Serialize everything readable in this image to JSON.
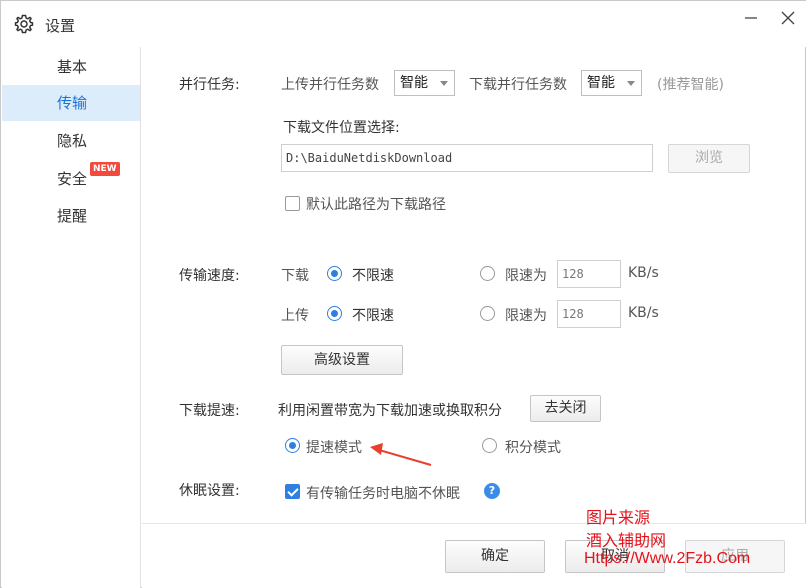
{
  "window": {
    "title": "设置"
  },
  "sidebar": {
    "items": [
      {
        "label": "基本"
      },
      {
        "label": "传输"
      },
      {
        "label": "隐私"
      },
      {
        "label": "安全",
        "badge": "NEW"
      },
      {
        "label": "提醒"
      }
    ],
    "active": "传输"
  },
  "parallel": {
    "label": "并行任务:",
    "upload_label": "上传并行任务数",
    "upload_value": "智能",
    "download_label": "下载并行任务数",
    "download_value": "智能",
    "hint": "(推荐智能)"
  },
  "download_location": {
    "label": "下载文件位置选择:",
    "path": "D:\\BaiduNetdiskDownload",
    "browse_label": "浏览",
    "default_checkbox_label": "默认此路径为下载路径",
    "default_checked": false
  },
  "speed": {
    "label": "传输速度:",
    "download": {
      "label": "下载",
      "unlimited_label": "不限速",
      "limit_label": "限速为",
      "limit_value": "128",
      "unit": "KB/s",
      "selected": "unlimited"
    },
    "upload": {
      "label": "上传",
      "unlimited_label": "不限速",
      "limit_label": "限速为",
      "limit_value": "128",
      "unit": "KB/s",
      "selected": "unlimited"
    },
    "advanced_button": "高级设置"
  },
  "boost": {
    "label": "下载提速:",
    "description": "利用闲置带宽为下载加速或换取积分",
    "close_button": "去关闭",
    "mode_speed_label": "提速模式",
    "mode_points_label": "积分模式",
    "selected": "speed"
  },
  "sleep": {
    "label": "休眠设置:",
    "checkbox_label": "有传输任务时电脑不休眠",
    "checked": true
  },
  "footer": {
    "ok_label": "确定",
    "cancel_label": "取消",
    "apply_label": "应用"
  },
  "watermark": {
    "line1": "图片来源",
    "line2": "酒入辅助网",
    "line3": "Https://Www.2Fzb.Com"
  },
  "colors": {
    "accent": "#2f7fe0",
    "active_bg": "#dcecfb",
    "badge": "#f24b3d",
    "watermark": "#e5121a",
    "arrow": "#e8402e"
  }
}
